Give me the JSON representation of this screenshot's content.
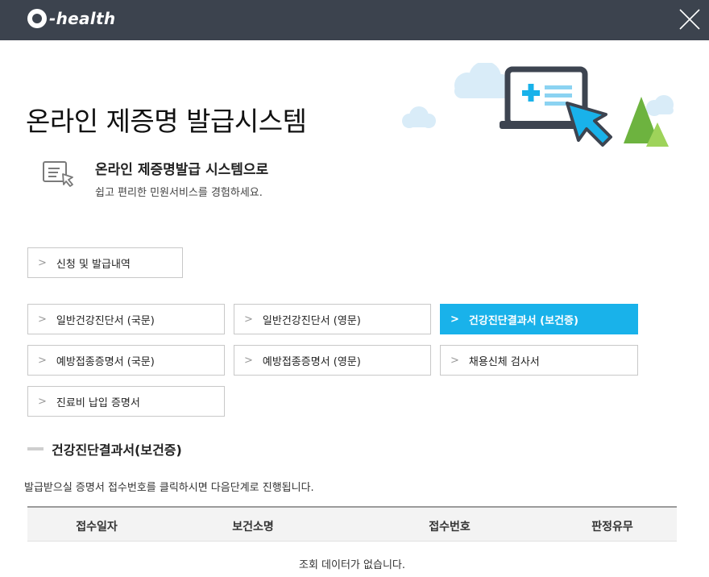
{
  "app": {
    "logo_text": "-health"
  },
  "hero": {
    "title": "온라인 제증명 발급시스템",
    "intro_heading": "온라인 제증명발급 시스템으로",
    "intro_sub": "쉽고 편리한 민원서비스를 경험하세요."
  },
  "history_button": {
    "label": "신청 및 발급내역"
  },
  "certificates": [
    {
      "label": "일반건강진단서 (국문)",
      "active": false
    },
    {
      "label": "일반건강진단서 (영문)",
      "active": false
    },
    {
      "label": "건강진단결과서 (보건증)",
      "active": true
    },
    {
      "label": "예방접종증명서 (국문)",
      "active": false
    },
    {
      "label": "예방접종증명서 (영문)",
      "active": false
    },
    {
      "label": "채용신체 검사서",
      "active": false
    },
    {
      "label": "진료비 납입 증명서",
      "active": false
    }
  ],
  "section": {
    "title": "건강진단결과서(보건증)",
    "instruction": "발급받으실 증명서 접수번호를 클릭하시면 다음단계로 진행됩니다."
  },
  "table": {
    "columns": [
      "접수일자",
      "보건소명",
      "접수번호",
      "판정유무"
    ],
    "empty_message": "조회 데이터가 없습니다."
  },
  "colors": {
    "titlebar": "#3c434e",
    "accent": "#19b2ea",
    "illustration_green": "#7cc242",
    "illustration_dark": "#3d4450"
  },
  "icons": {
    "logo": "g-logo-icon",
    "close": "close-icon",
    "intro": "document-cursor-icon",
    "chevron": "chevron-right-icon"
  }
}
